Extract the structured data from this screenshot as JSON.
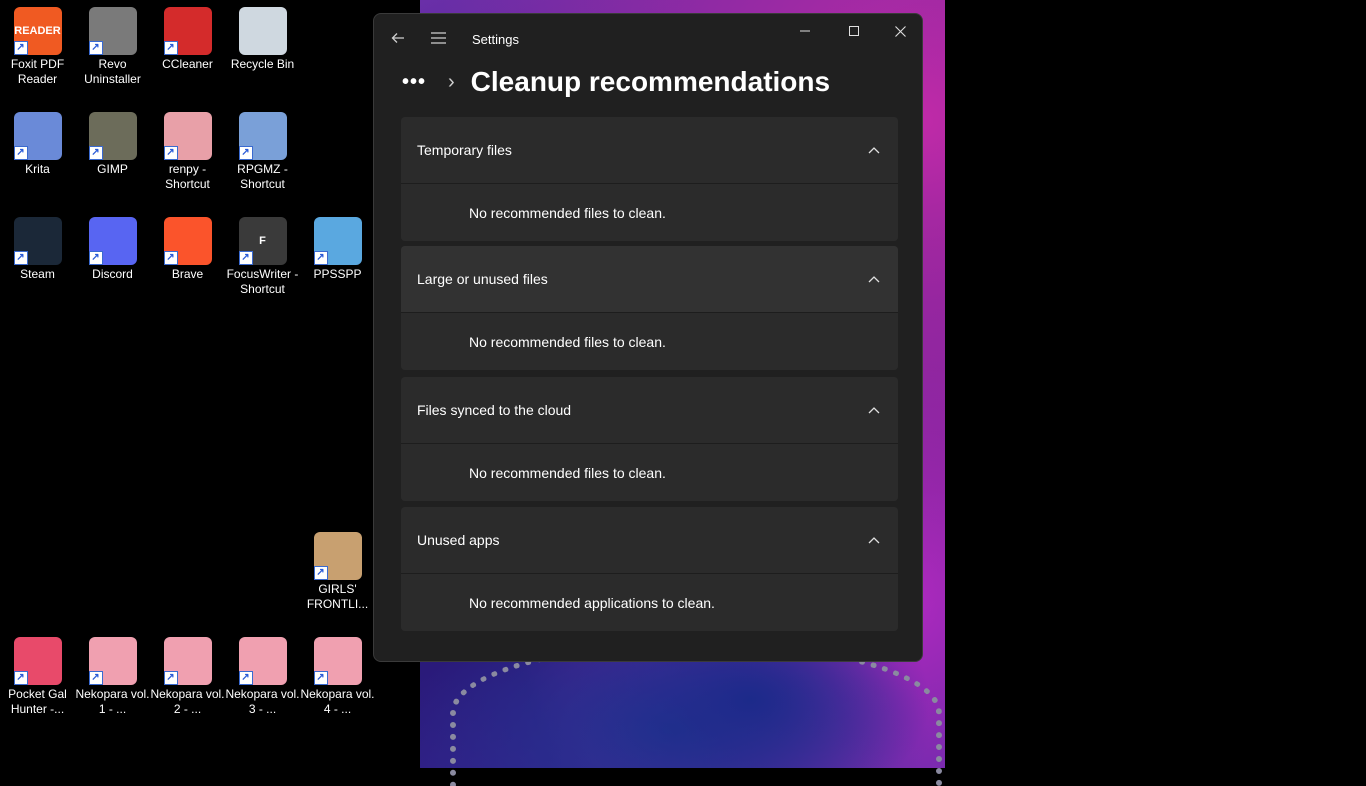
{
  "desktop": {
    "icons": [
      {
        "label": "Foxit PDF Reader",
        "badge": "READER",
        "color": "#f05a22"
      },
      {
        "label": "Revo Uninstaller",
        "badge": "",
        "color": "#7a7a7a"
      },
      {
        "label": "CCleaner",
        "badge": "",
        "color": "#d42b2b"
      },
      {
        "label": "Recycle Bin",
        "badge": "",
        "color": "#cfd8e0"
      },
      {
        "label": "Krita",
        "badge": "",
        "color": "#6a8ad8"
      },
      {
        "label": "GIMP",
        "badge": "",
        "color": "#6c6c5a"
      },
      {
        "label": "renpy - Shortcut",
        "badge": "",
        "color": "#e8a0a8"
      },
      {
        "label": "RPGMZ - Shortcut",
        "badge": "",
        "color": "#7aa0d8"
      },
      {
        "label": "Steam",
        "badge": "",
        "color": "#1b2838"
      },
      {
        "label": "Discord",
        "badge": "",
        "color": "#5865f2"
      },
      {
        "label": "Brave",
        "badge": "",
        "color": "#fb542b"
      },
      {
        "label": "FocusWriter - Shortcut",
        "badge": "F",
        "color": "#3a3a3a"
      },
      {
        "label": "PPSSPP",
        "badge": "",
        "color": "#5aa8e0"
      },
      {
        "label": "GIRLS' FRONTLI...",
        "badge": "",
        "color": "#c8a070"
      },
      {
        "label": "Pocket Gal Hunter -...",
        "badge": "",
        "color": "#e84a6a"
      },
      {
        "label": "Nekopara vol. 1 - ...",
        "badge": "",
        "color": "#f0a0b0"
      },
      {
        "label": "Nekopara vol. 2 - ...",
        "badge": "",
        "color": "#f0a0b0"
      },
      {
        "label": "Nekopara vol. 3 - ...",
        "badge": "",
        "color": "#f0a0b0"
      },
      {
        "label": "Nekopara vol. 4 - ...",
        "badge": "",
        "color": "#f0a0b0"
      }
    ]
  },
  "window": {
    "title": "Settings",
    "breadcrumb_overflow": "•••",
    "page_title": "Cleanup recommendations",
    "sections": [
      {
        "title": "Temporary files",
        "message": "No recommended files to clean."
      },
      {
        "title": "Large or unused files",
        "message": "No recommended files to clean."
      },
      {
        "title": "Files synced to the cloud",
        "message": "No recommended files to clean."
      },
      {
        "title": "Unused apps",
        "message": "No recommended applications to clean."
      }
    ]
  }
}
